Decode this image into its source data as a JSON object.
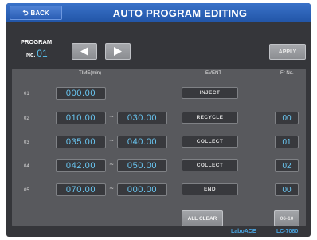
{
  "header": {
    "back_label": "BACK",
    "back_icon": "return-arrow-icon",
    "title": "AUTO PROGRAM EDITING"
  },
  "program": {
    "label": "PROGRAM",
    "no_label": "No.",
    "number": "01",
    "prev_icon": "triangle-left-icon",
    "next_icon": "triangle-right-icon",
    "apply_label": "APPLY"
  },
  "table": {
    "headers": {
      "time": "TIME(min)",
      "event": "EVENT",
      "frno": "Fr No."
    },
    "rows": [
      {
        "num": "01",
        "start": "000.00",
        "end": "",
        "event": "INJECT",
        "fr_no": ""
      },
      {
        "num": "02",
        "start": "010.00",
        "end": "030.00",
        "event": "RECYCLE",
        "fr_no": "00"
      },
      {
        "num": "03",
        "start": "035.00",
        "end": "040.00",
        "event": "COLLECT",
        "fr_no": "01"
      },
      {
        "num": "04",
        "start": "042.00",
        "end": "050.00",
        "event": "COLLECT",
        "fr_no": "02"
      },
      {
        "num": "05",
        "start": "070.00",
        "end": "000.00",
        "event": "END",
        "fr_no": "00"
      }
    ],
    "range_separator": "~"
  },
  "footer": {
    "all_clear_label": "ALL CLEAR",
    "page_label": "06-10",
    "brand": "LaboACE",
    "model": "LC-7080"
  },
  "colors": {
    "header_blue": "#2d63b8",
    "value_cyan": "#69c6f2",
    "panel_gray": "#58595d",
    "background_dark": "#35363a",
    "brand_blue": "#4aa5e0"
  }
}
